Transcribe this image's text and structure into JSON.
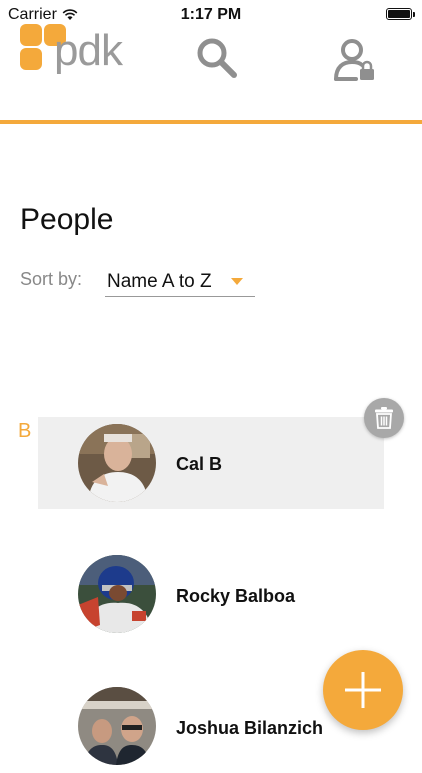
{
  "status_bar": {
    "carrier": "Carrier",
    "time": "1:17 PM"
  },
  "header": {
    "logo_text": "pdk",
    "search_icon": "search-icon",
    "user_lock_icon": "user-lock-icon",
    "accent_color": "#f4a93b"
  },
  "page": {
    "title": "People"
  },
  "sort": {
    "label": "Sort by:",
    "value": "Name A to Z"
  },
  "list": {
    "section_letter": "B",
    "people": [
      {
        "name": "Cal B",
        "selected": true
      },
      {
        "name": "Rocky Balboa",
        "selected": false
      },
      {
        "name": "Joshua Bilanzich",
        "selected": false
      }
    ]
  },
  "actions": {
    "delete_icon": "trash-icon",
    "add_icon": "plus-icon"
  }
}
